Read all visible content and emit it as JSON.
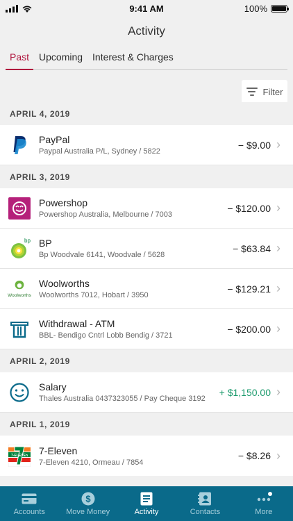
{
  "status_bar": {
    "time": "9:41 AM",
    "battery_pct": "100%"
  },
  "header": {
    "title": "Activity"
  },
  "tabs": [
    {
      "label": "Past",
      "active": true
    },
    {
      "label": "Upcoming",
      "active": false
    },
    {
      "label": "Interest & Charges",
      "active": false
    }
  ],
  "filter": {
    "label": "Filter"
  },
  "groups": [
    {
      "date": "APRIL 4, 2019",
      "items": [
        {
          "name": "PayPal",
          "sub": "Paypal Australia P/L, Sydney / 5822",
          "amount": "$9.00",
          "sign": "−",
          "type": "debit",
          "icon": "paypal-logo"
        }
      ]
    },
    {
      "date": "APRIL 3, 2019",
      "items": [
        {
          "name": "Powershop",
          "sub": "Powershop Australia, Melbourne / 7003",
          "amount": "$120.00",
          "sign": "−",
          "type": "debit",
          "icon": "powershop-logo"
        },
        {
          "name": "BP",
          "sub": "Bp Woodvale 6141, Woodvale / 5628",
          "amount": "$63.84",
          "sign": "−",
          "type": "debit",
          "icon": "bp-logo"
        },
        {
          "name": "Woolworths",
          "sub": "Woolworths 7012, Hobart / 3950",
          "amount": "$129.21",
          "sign": "−",
          "type": "debit",
          "icon": "woolworths-logo"
        },
        {
          "name": "Withdrawal - ATM",
          "sub": "BBL- Bendigo Cntrl Lobb Bendig / 3721",
          "amount": "$200.00",
          "sign": "−",
          "type": "debit",
          "icon": "atm-icon"
        }
      ]
    },
    {
      "date": "APRIL 2, 2019",
      "items": [
        {
          "name": "Salary",
          "sub": "Thales Australia 0437323055 / Pay Cheque 3192",
          "amount": "$1,150.00",
          "sign": "+",
          "type": "credit",
          "icon": "smiley-icon"
        }
      ]
    },
    {
      "date": "APRIL 1, 2019",
      "items": [
        {
          "name": "7-Eleven",
          "sub": "7-Eleven 4210, Ormeau / 7854",
          "amount": "$8.26",
          "sign": "−",
          "type": "debit",
          "icon": "seven-eleven-logo"
        }
      ]
    }
  ],
  "logo_text": {
    "bp": "bp",
    "woolworths": "Woolworths",
    "seven_eleven": "7-ELEVEn"
  },
  "bottom_nav": [
    {
      "label": "Accounts",
      "icon": "card-icon",
      "active": false
    },
    {
      "label": "Move Money",
      "icon": "dollar-icon",
      "active": false
    },
    {
      "label": "Activity",
      "icon": "document-icon",
      "active": true
    },
    {
      "label": "Contacts",
      "icon": "contacts-icon",
      "active": false
    },
    {
      "label": "More",
      "icon": "more-icon",
      "active": false
    }
  ],
  "colors": {
    "accent": "#b0163e",
    "nav_bg": "#0a6a8a",
    "credit": "#1a9a6c"
  }
}
